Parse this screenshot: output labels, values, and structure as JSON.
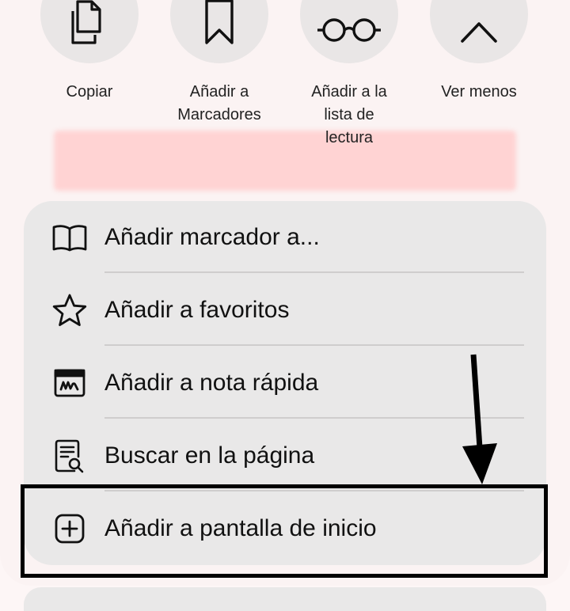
{
  "actions": [
    {
      "label": "Copiar",
      "icon": "copy-icon"
    },
    {
      "label": "Añadir a\nMarcadores",
      "icon": "bookmark-icon"
    },
    {
      "label": "Añadir a la\nlista de\nlectura",
      "icon": "glasses-icon"
    },
    {
      "label": "Ver menos",
      "icon": "chevron-up-icon"
    }
  ],
  "menu": {
    "items": [
      {
        "label": "Añadir marcador a...",
        "icon": "book-icon"
      },
      {
        "label": "Añadir a favoritos",
        "icon": "star-icon"
      },
      {
        "label": "Añadir a nota rápida",
        "icon": "quick-note-icon"
      },
      {
        "label": "Buscar en la página",
        "icon": "find-in-page-icon"
      },
      {
        "label": "Añadir a pantalla de inicio",
        "icon": "add-square-icon"
      }
    ]
  },
  "annotation": {
    "arrow_color": "#000000",
    "box_color": "#000000"
  }
}
